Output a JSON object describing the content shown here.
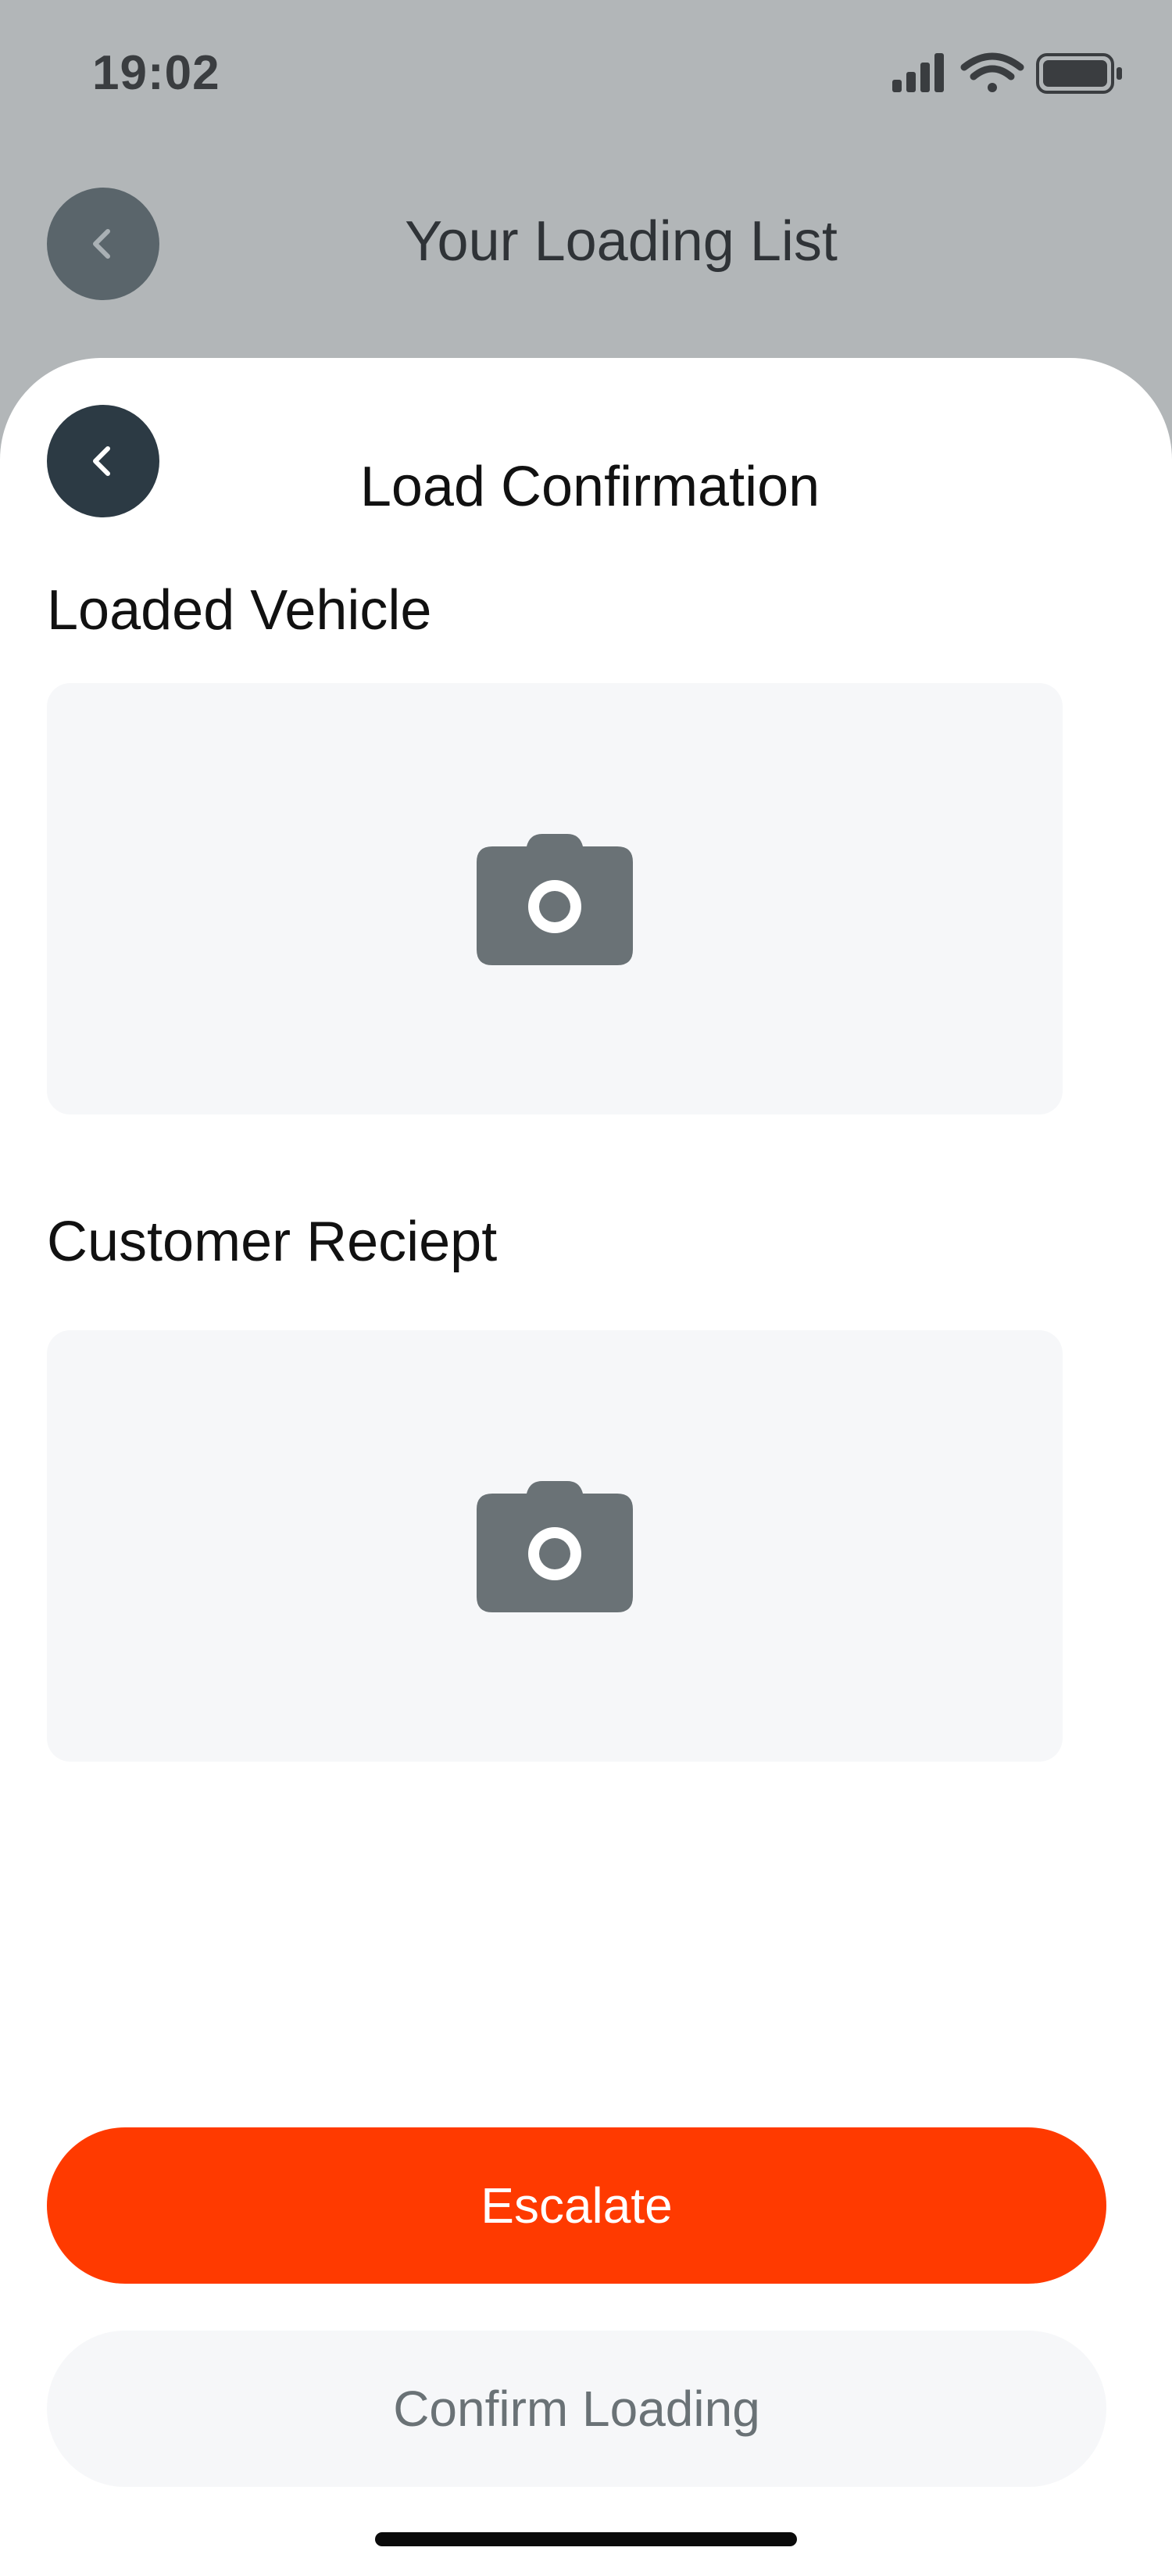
{
  "status_bar": {
    "time": "19:02",
    "icons": [
      "cellular-signal-icon",
      "wifi-icon",
      "battery-icon"
    ]
  },
  "background_screen": {
    "title": "Your Loading List"
  },
  "sheet": {
    "title": "Load Confirmation",
    "sections": [
      {
        "label": "Loaded Vehicle",
        "icon": "camera-icon"
      },
      {
        "label": "Customer Reciept",
        "icon": "camera-icon"
      }
    ]
  },
  "actions": {
    "escalate_label": "Escalate",
    "confirm_label": "Confirm Loading"
  },
  "colors": {
    "accent": "#ff3a00",
    "dark_button": "#2c3a44",
    "photo_box_bg": "#f6f7f9",
    "camera_icon": "#6a7276"
  }
}
